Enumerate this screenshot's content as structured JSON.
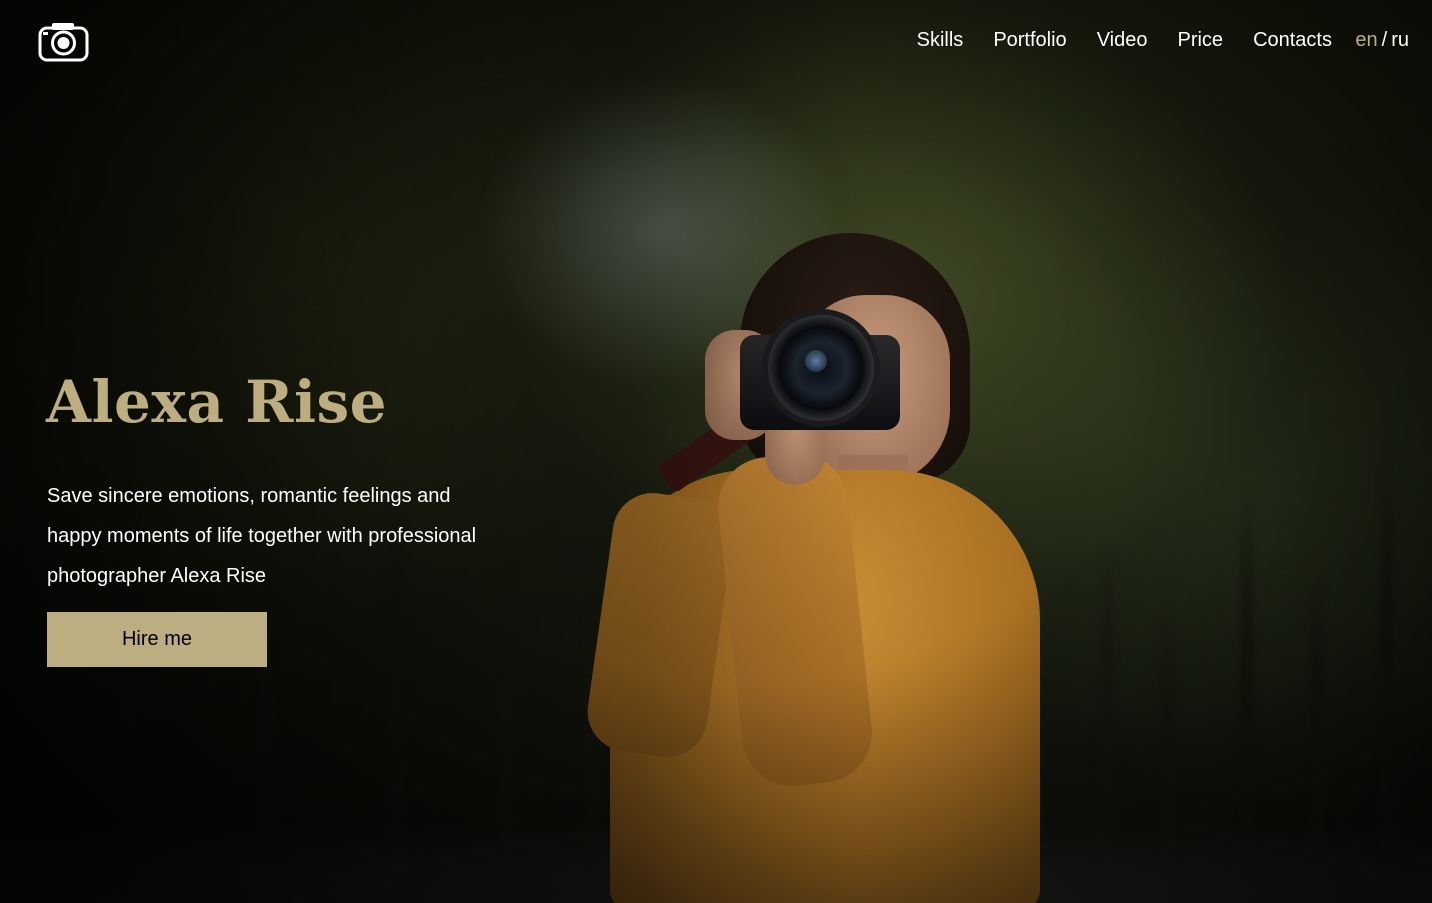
{
  "header": {
    "logo_icon": "camera-icon",
    "nav": {
      "skills": "Skills",
      "portfolio": "Portfolio",
      "video": "Video",
      "price": "Price",
      "contacts": "Contacts"
    },
    "lang": {
      "en": "en",
      "separator": "/",
      "ru": "ru"
    }
  },
  "hero": {
    "title": "Alexa Rise",
    "subtitle": "Save sincere emotions, romantic feelings and happy moments of life together with professional photographer Alexa Rise",
    "cta_label": "Hire me"
  },
  "colors": {
    "accent": "#bdae82",
    "text": "#ffffff"
  }
}
